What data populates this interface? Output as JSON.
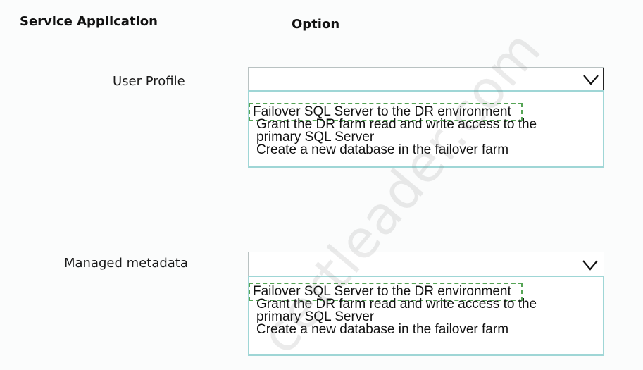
{
  "headers": {
    "service_application": "Service Application",
    "option": "Option"
  },
  "rows": [
    {
      "label": "User Profile",
      "select": {
        "value": "",
        "chevron_icon": "chevron-down-icon",
        "options": [
          "Failover SQL Server to the DR environment",
          "Grant the DR farm read and write access to the",
          "primary SQL Server",
          "Create a new database in the failover farm"
        ],
        "highlighted_index": 0
      }
    },
    {
      "label": "Managed metadata",
      "select": {
        "value": "",
        "chevron_icon": "chevron-down-icon",
        "options": [
          "Failover SQL Server to the DR environment",
          "Grant the DR farm read and write access to the",
          "primary SQL Server",
          "Create a new database in the failover farm"
        ],
        "highlighted_index": 0
      }
    }
  ],
  "watermark": "certleader.com",
  "colors": {
    "list_border": "#9fd6d6",
    "highlight_dash": "#55a455"
  }
}
